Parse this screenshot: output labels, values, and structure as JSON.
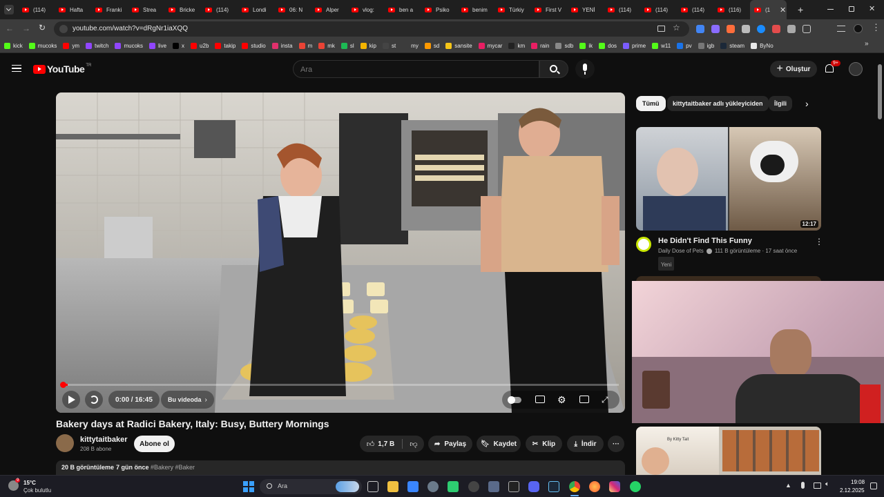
{
  "browser": {
    "tabs": [
      "(114)",
      "Hafta",
      "Franki",
      "Strea",
      "Bricke",
      "(114)",
      "Londi",
      "06: N",
      "Alper",
      "vlog:",
      "ben a",
      "Psiko",
      "benim",
      "Türkiy",
      "First V",
      "YENİ",
      "(114)",
      "(114)",
      "(114)",
      "(116)",
      "(1"
    ],
    "url": "youtube.com/watch?v=dRgNr1iaXQQ",
    "bookmarks": [
      {
        "label": "kick",
        "color": "#53fc18"
      },
      {
        "label": "mucoks",
        "color": "#53fc18"
      },
      {
        "label": "ym",
        "color": "#ff0000"
      },
      {
        "label": "twitch",
        "color": "#9146ff"
      },
      {
        "label": "mucoks",
        "color": "#9146ff"
      },
      {
        "label": "live",
        "color": "#9146ff"
      },
      {
        "label": "x",
        "color": "#000000"
      },
      {
        "label": "u2b",
        "color": "#ff0000"
      },
      {
        "label": "takip",
        "color": "#ff0000"
      },
      {
        "label": "studio",
        "color": "#ff0000"
      },
      {
        "label": "insta",
        "color": "#e1306c"
      },
      {
        "label": "m",
        "color": "#ea4335"
      },
      {
        "label": "mk",
        "color": "#ea4335"
      },
      {
        "label": "sl",
        "color": "#1db954"
      },
      {
        "label": "kip",
        "color": "#f4b400"
      },
      {
        "label": "st",
        "color": "#444444"
      },
      {
        "label": "my",
        "color": "#3c3c3c"
      },
      {
        "label": "sd",
        "color": "#ff9900"
      },
      {
        "label": "sansite",
        "color": "#f5c518"
      },
      {
        "label": "mycar",
        "color": "#e91e63"
      },
      {
        "label": "km",
        "color": "#222222"
      },
      {
        "label": "rain",
        "color": "#e91e63"
      },
      {
        "label": "sdb",
        "color": "#888888"
      },
      {
        "label": "ik",
        "color": "#53fc18"
      },
      {
        "label": "dos",
        "color": "#53fc18"
      },
      {
        "label": "prime",
        "color": "#7b5cff"
      },
      {
        "label": "w11",
        "color": "#53fc18"
      },
      {
        "label": "pv",
        "color": "#1a73e8"
      },
      {
        "label": "igb",
        "color": "#777777"
      },
      {
        "label": "steam",
        "color": "#1b2838"
      },
      {
        "label": "ByNo",
        "color": "#e8e8e8"
      }
    ]
  },
  "youtube": {
    "logo_text": "YouTube",
    "logo_sup": "TR",
    "search_placeholder": "Ara",
    "create_label": "Oluştur",
    "notif_count": "9+",
    "player": {
      "time": "0:00 / 16:45",
      "chapter": "Bu videoda",
      "progress": 0.01
    },
    "video": {
      "title": "Bakery days at Radici Bakery, Italy: Busy, Buttery Mornings",
      "channel": "kittytaitbaker",
      "subs": "208 B abone",
      "subscribe": "Abone ol",
      "likes": "1,7 B",
      "share": "Paylaş",
      "save": "Kaydet",
      "clip": "Klip",
      "download": "İndir",
      "views": "20 B görüntüleme",
      "age": "7 gün önce",
      "tags": "#Bakery #Baker"
    },
    "chips": [
      "Tümü",
      "kittytaitbaker adlı yükleyiciden",
      "İlgili"
    ],
    "related": {
      "duration": "12:17",
      "title": "He Didn't Find This Funny",
      "channel": "Daily Dose of Pets",
      "meta": "111 B görüntüleme · 17 saat önce",
      "badge": "Yeni",
      "thumb3_text": "By Kitty Tait"
    }
  },
  "taskbar": {
    "temp": "15°C",
    "weather": "Çok bulutlu",
    "weather_badge": "9",
    "search": "Ara",
    "time": "19:08",
    "date": "2.12.2025"
  }
}
